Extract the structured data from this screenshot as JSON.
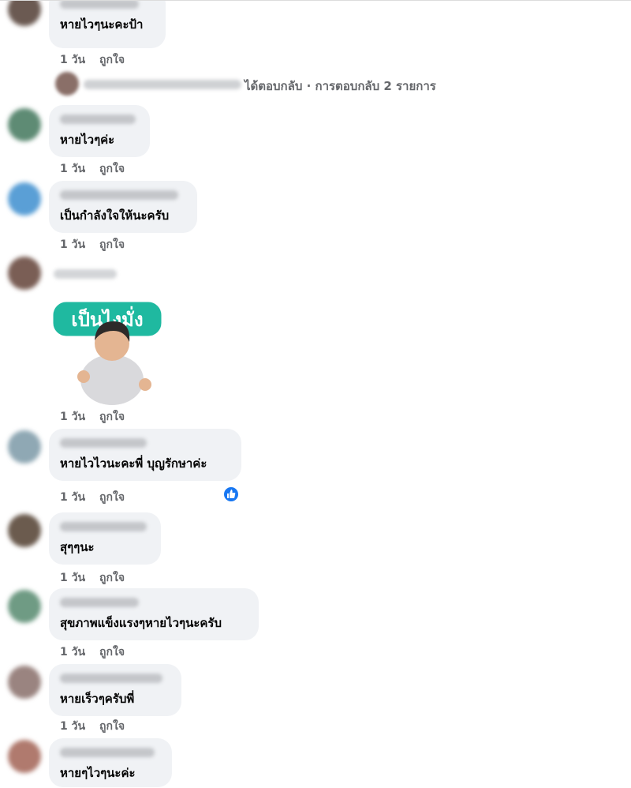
{
  "comments": [
    {
      "text": "หายไวๆนะคะป้า",
      "time": "1 วัน",
      "like": "ถูกใจ"
    },
    {
      "text": "หายไวๆค่ะ",
      "time": "1 วัน",
      "like": "ถูกใจ"
    },
    {
      "text": "เป็นกำลังใจให้นะครับ",
      "time": "1 วัน",
      "like": "ถูกใจ"
    },
    {
      "text": "",
      "time": "1 วัน",
      "like": "ถูกใจ",
      "sticker_text": "เป็นไงมั่ง"
    },
    {
      "text": "หายไวไวนะคะพี่ บุญรักษาค่ะ",
      "time": "1 วัน",
      "like": "ถูกใจ"
    },
    {
      "text": "สุๆๆนะ",
      "time": "1 วัน",
      "like": "ถูกใจ"
    },
    {
      "text": "สุขภาพแข็งแรงๆหายไวๆนะครับ",
      "time": "1 วัน",
      "like": "ถูกใจ"
    },
    {
      "text": "หายเร็วๆครับพี่",
      "time": "1 วัน",
      "like": "ถูกใจ"
    },
    {
      "text": "หายๆไวๆนะค่ะ",
      "time": "",
      "like": ""
    }
  ],
  "reply_summary": "ได้ตอบกลับ · การตอบกลับ 2 รายการ",
  "colors": {
    "bubble": "#f0f2f5",
    "meta": "#65676b",
    "like_reaction": "#1877f2",
    "sticker_green": "#1fb9a0"
  },
  "icons": {
    "reaction": "thumbs-up-icon"
  }
}
